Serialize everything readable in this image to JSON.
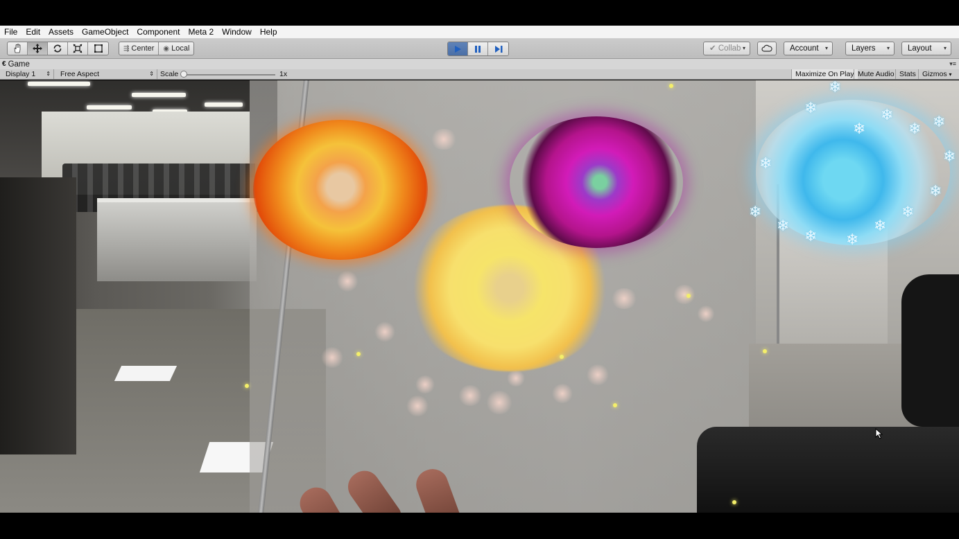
{
  "menu": [
    "File",
    "Edit",
    "Assets",
    "GameObject",
    "Component",
    "Meta 2",
    "Window",
    "Help"
  ],
  "toolbar": {
    "tools": [
      {
        "name": "hand-tool",
        "active": false
      },
      {
        "name": "move-tool",
        "active": true
      },
      {
        "name": "rotate-tool",
        "active": false
      },
      {
        "name": "scale-tool",
        "active": false
      },
      {
        "name": "rect-tool",
        "active": false
      }
    ],
    "pivot_label": "Center",
    "space_label": "Local",
    "collab_label": "Collab",
    "account_label": "Account",
    "layers_label": "Layers",
    "layout_label": "Layout"
  },
  "game_tab": {
    "label": "Game",
    "display": "Display 1",
    "aspect": "Free Aspect",
    "scale_label": "Scale",
    "scale_value": "1x",
    "scale_fraction": 0.0,
    "maximize_label": "Maximize On Play",
    "mute_label": "Mute Audio",
    "stats_label": "Stats",
    "gizmos_label": "Gizmos"
  },
  "colors": {
    "play_active": "#5f83b8",
    "play_icon": "#1f5fbf"
  }
}
